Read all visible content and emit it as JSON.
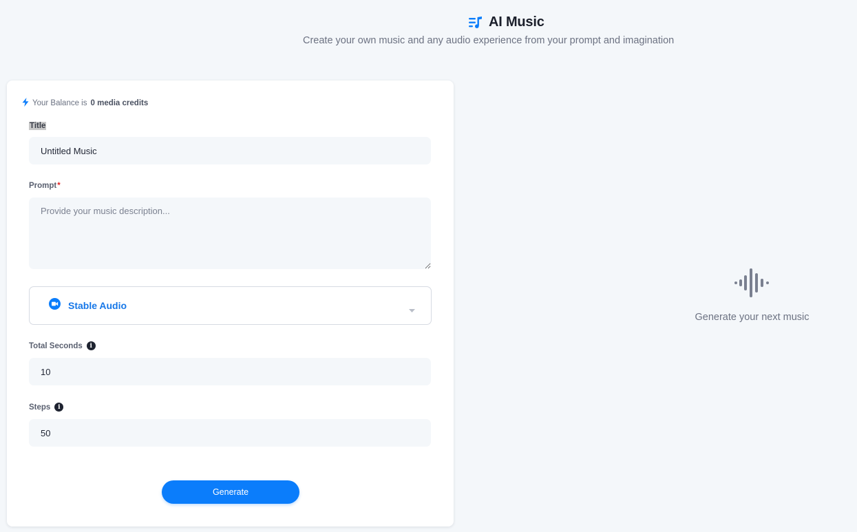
{
  "header": {
    "title": "AI Music",
    "subtitle": "Create your own music and any audio experience from your prompt and imagination",
    "icon": "music-list-icon"
  },
  "form": {
    "balance_prefix": "Your Balance is",
    "balance_value": "0 media credits",
    "title_label": "Title",
    "title_value": "Untitled Music",
    "prompt_label": "Prompt",
    "prompt_required": "*",
    "prompt_placeholder": "Provide your music description...",
    "prompt_value": "",
    "model_selected": "Stable Audio",
    "total_seconds_label": "Total Seconds",
    "total_seconds_value": "10",
    "steps_label": "Steps",
    "steps_value": "50",
    "generate_label": "Generate"
  },
  "preview": {
    "empty_text": "Generate your next music",
    "icon": "audio-waveform-icon"
  },
  "colors": {
    "accent": "#0b7dfb",
    "background": "#f4f7fa",
    "required": "#e02424"
  }
}
